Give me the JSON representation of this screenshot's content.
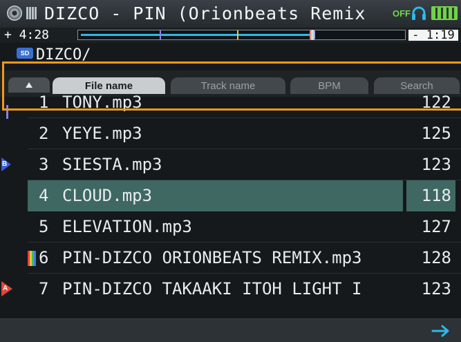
{
  "header": {
    "track_title": "DIZCO - PIN (Orionbeats Remix",
    "sync_status": "OFF",
    "disc_icon": "disc-icon",
    "card_icon": "sd-card-icon",
    "headphones_icon": "headphones-icon",
    "battery_icon": "battery-icon"
  },
  "transport": {
    "elapsed": "+ 4:28",
    "remaining": "- 1:19",
    "progress": 0.72
  },
  "browser": {
    "path": "DIZCO/",
    "source_icon_label": "SD",
    "tabs": [
      {
        "label": "File name",
        "active": true
      },
      {
        "label": "Track name",
        "active": false
      },
      {
        "label": "BPM",
        "active": false
      },
      {
        "label": "Search",
        "active": false
      }
    ],
    "rows": [
      {
        "num": "1",
        "name": "TONY.mp3",
        "bpm": "122"
      },
      {
        "num": "2",
        "name": "YEYE.mp3",
        "bpm": "125"
      },
      {
        "num": "3",
        "name": "SIESTA.mp3",
        "bpm": "123",
        "marker": "B"
      },
      {
        "num": "4",
        "name": "CLOUD.mp3",
        "bpm": "118",
        "selected": true
      },
      {
        "num": "5",
        "name": "ELEVATION.mp3",
        "bpm": "127"
      },
      {
        "num": "6",
        "name": "PIN-DIZCO ORIONBEATS REMIX.mp3",
        "bpm": "128"
      },
      {
        "num": "7",
        "name": "PIN-DIZCO TAKAAKI ITOH LIGHT I",
        "bpm": "123",
        "marker": "A"
      }
    ]
  },
  "footer": {
    "next_icon": "arrow-right-icon"
  },
  "colors": {
    "accent_highlight": "#f09a14",
    "selected_row": "#3f6863",
    "progress": "#2fb8e8",
    "sync_off": "#74d34d"
  }
}
